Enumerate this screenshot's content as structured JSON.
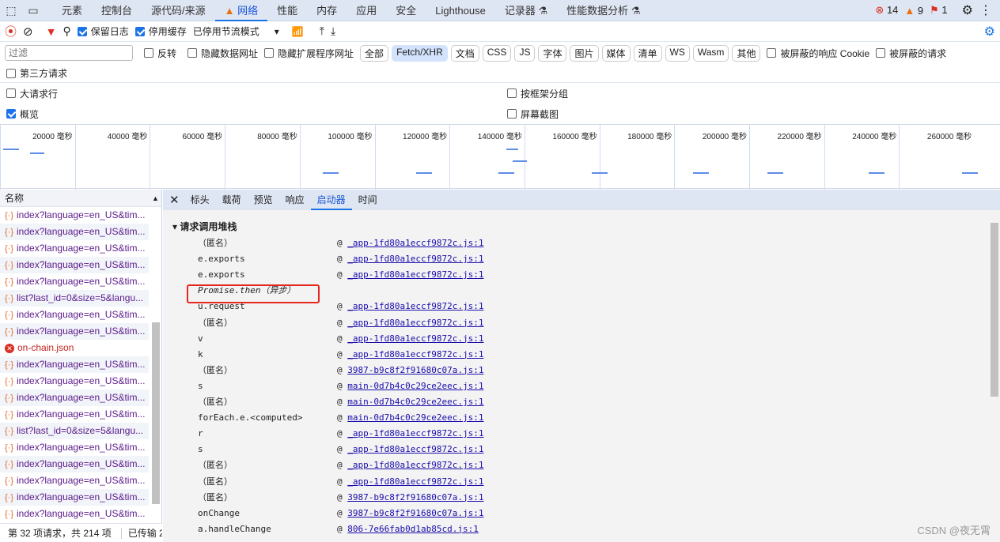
{
  "tabs": [
    "元素",
    "控制台",
    "源代码/来源",
    "网络",
    "性能",
    "内存",
    "应用",
    "安全",
    "Lighthouse",
    "记录器 ⚗",
    "性能数据分析 ⚗"
  ],
  "counts": {
    "errors": "14",
    "warnings": "9",
    "issues": "1"
  },
  "toolbar": {
    "preserve_log": "保留日志",
    "disable_cache": "停用缓存",
    "throttle": "已停用节流模式"
  },
  "filter": {
    "placeholder": "过滤",
    "invert": "反转",
    "hide_data": "隐藏数据网址",
    "hide_ext": "隐藏扩展程序网址",
    "chips": [
      "全部",
      "Fetch/XHR",
      "文档",
      "CSS",
      "JS",
      "字体",
      "图片",
      "媒体",
      "清单",
      "WS",
      "Wasm",
      "其他"
    ],
    "active_chip": "Fetch/XHR",
    "blocked_cookie": "被屏蔽的响应 Cookie",
    "blocked_req": "被屏蔽的请求",
    "third_party": "第三方请求"
  },
  "options": {
    "big_rows": "大请求行",
    "group_frame": "按框架分组",
    "overview": "概览",
    "screenshots": "屏幕截图"
  },
  "timeline": [
    "20000 毫秒",
    "40000 毫秒",
    "60000 毫秒",
    "80000 毫秒",
    "100000 毫秒",
    "120000 毫秒",
    "140000 毫秒",
    "160000 毫秒",
    "180000 毫秒",
    "200000 毫秒",
    "220000 毫秒",
    "240000 毫秒",
    "260000 毫秒"
  ],
  "list": {
    "header": "名称",
    "items": [
      "index?language=en_US&tim...",
      "index?language=en_US&tim...",
      "index?language=en_US&tim...",
      "index?language=en_US&tim...",
      "index?language=en_US&tim...",
      "list?last_id=0&size=5&langu...",
      "index?language=en_US&tim...",
      "index?language=en_US&tim...",
      "on-chain.json",
      "index?language=en_US&tim...",
      "index?language=en_US&tim...",
      "index?language=en_US&tim...",
      "index?language=en_US&tim...",
      "list?last_id=0&size=5&langu...",
      "index?language=en_US&tim...",
      "index?language=en_US&tim...",
      "index?language=en_US&tim...",
      "index?language=en_US&tim...",
      "index?language=en_US&tim..."
    ],
    "status": "第 32 项请求，共 214 项",
    "transferred": "已传输 2"
  },
  "detail": {
    "tabs": [
      "标头",
      "载荷",
      "预览",
      "响应",
      "启动器",
      "时间"
    ],
    "active": "启动器",
    "section": "请求调用堆栈",
    "stack": [
      {
        "fn": "（匿名）",
        "src": "_app-1fd80a1eccf9872c.js:1"
      },
      {
        "fn": "e.exports",
        "src": "_app-1fd80a1eccf9872c.js:1"
      },
      {
        "fn": "e.exports",
        "src": "_app-1fd80a1eccf9872c.js:1"
      },
      {
        "fn": "Promise.then（异步）",
        "src": ""
      },
      {
        "fn": "u.request",
        "src": "_app-1fd80a1eccf9872c.js:1"
      },
      {
        "fn": "（匿名）",
        "src": "_app-1fd80a1eccf9872c.js:1"
      },
      {
        "fn": "v",
        "src": "_app-1fd80a1eccf9872c.js:1"
      },
      {
        "fn": "k",
        "src": "_app-1fd80a1eccf9872c.js:1"
      },
      {
        "fn": "（匿名）",
        "src": "3987-b9c8f2f91680c07a.js:1"
      },
      {
        "fn": "s",
        "src": "main-0d7b4c0c29ce2eec.js:1"
      },
      {
        "fn": "（匿名）",
        "src": "main-0d7b4c0c29ce2eec.js:1"
      },
      {
        "fn": "forEach.e.<computed>",
        "src": "main-0d7b4c0c29ce2eec.js:1"
      },
      {
        "fn": "r",
        "src": "_app-1fd80a1eccf9872c.js:1"
      },
      {
        "fn": "s",
        "src": "_app-1fd80a1eccf9872c.js:1"
      },
      {
        "fn": "（匿名）",
        "src": "_app-1fd80a1eccf9872c.js:1"
      },
      {
        "fn": "（匿名）",
        "src": "_app-1fd80a1eccf9872c.js:1"
      },
      {
        "fn": "（匿名）",
        "src": "3987-b9c8f2f91680c07a.js:1"
      },
      {
        "fn": "onChange",
        "src": "3987-b9c8f2f91680c07a.js:1"
      },
      {
        "fn": "a.handleChange",
        "src": "806-7e66fab0d1ab85cd.js:1"
      }
    ]
  },
  "watermark": "CSDN @夜无霄"
}
